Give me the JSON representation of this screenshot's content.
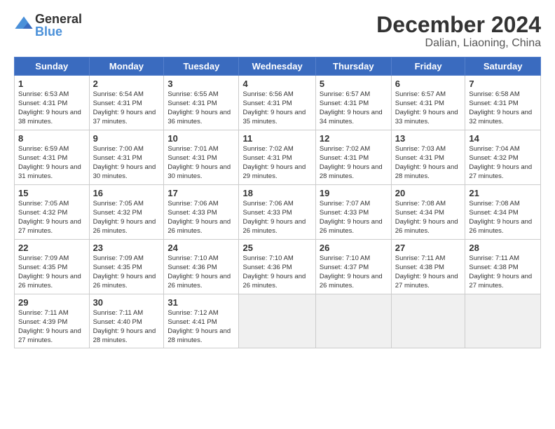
{
  "logo": {
    "text_general": "General",
    "text_blue": "Blue"
  },
  "header": {
    "title": "December 2024",
    "subtitle": "Dalian, Liaoning, China"
  },
  "weekdays": [
    "Sunday",
    "Monday",
    "Tuesday",
    "Wednesday",
    "Thursday",
    "Friday",
    "Saturday"
  ],
  "weeks": [
    [
      {
        "day": "1",
        "sunrise": "6:53 AM",
        "sunset": "4:31 PM",
        "daylight": "9 hours and 38 minutes."
      },
      {
        "day": "2",
        "sunrise": "6:54 AM",
        "sunset": "4:31 PM",
        "daylight": "9 hours and 37 minutes."
      },
      {
        "day": "3",
        "sunrise": "6:55 AM",
        "sunset": "4:31 PM",
        "daylight": "9 hours and 36 minutes."
      },
      {
        "day": "4",
        "sunrise": "6:56 AM",
        "sunset": "4:31 PM",
        "daylight": "9 hours and 35 minutes."
      },
      {
        "day": "5",
        "sunrise": "6:57 AM",
        "sunset": "4:31 PM",
        "daylight": "9 hours and 34 minutes."
      },
      {
        "day": "6",
        "sunrise": "6:57 AM",
        "sunset": "4:31 PM",
        "daylight": "9 hours and 33 minutes."
      },
      {
        "day": "7",
        "sunrise": "6:58 AM",
        "sunset": "4:31 PM",
        "daylight": "9 hours and 32 minutes."
      }
    ],
    [
      {
        "day": "8",
        "sunrise": "6:59 AM",
        "sunset": "4:31 PM",
        "daylight": "9 hours and 31 minutes."
      },
      {
        "day": "9",
        "sunrise": "7:00 AM",
        "sunset": "4:31 PM",
        "daylight": "9 hours and 30 minutes."
      },
      {
        "day": "10",
        "sunrise": "7:01 AM",
        "sunset": "4:31 PM",
        "daylight": "9 hours and 30 minutes."
      },
      {
        "day": "11",
        "sunrise": "7:02 AM",
        "sunset": "4:31 PM",
        "daylight": "9 hours and 29 minutes."
      },
      {
        "day": "12",
        "sunrise": "7:02 AM",
        "sunset": "4:31 PM",
        "daylight": "9 hours and 28 minutes."
      },
      {
        "day": "13",
        "sunrise": "7:03 AM",
        "sunset": "4:31 PM",
        "daylight": "9 hours and 28 minutes."
      },
      {
        "day": "14",
        "sunrise": "7:04 AM",
        "sunset": "4:32 PM",
        "daylight": "9 hours and 27 minutes."
      }
    ],
    [
      {
        "day": "15",
        "sunrise": "7:05 AM",
        "sunset": "4:32 PM",
        "daylight": "9 hours and 27 minutes."
      },
      {
        "day": "16",
        "sunrise": "7:05 AM",
        "sunset": "4:32 PM",
        "daylight": "9 hours and 26 minutes."
      },
      {
        "day": "17",
        "sunrise": "7:06 AM",
        "sunset": "4:33 PM",
        "daylight": "9 hours and 26 minutes."
      },
      {
        "day": "18",
        "sunrise": "7:06 AM",
        "sunset": "4:33 PM",
        "daylight": "9 hours and 26 minutes."
      },
      {
        "day": "19",
        "sunrise": "7:07 AM",
        "sunset": "4:33 PM",
        "daylight": "9 hours and 26 minutes."
      },
      {
        "day": "20",
        "sunrise": "7:08 AM",
        "sunset": "4:34 PM",
        "daylight": "9 hours and 26 minutes."
      },
      {
        "day": "21",
        "sunrise": "7:08 AM",
        "sunset": "4:34 PM",
        "daylight": "9 hours and 26 minutes."
      }
    ],
    [
      {
        "day": "22",
        "sunrise": "7:09 AM",
        "sunset": "4:35 PM",
        "daylight": "9 hours and 26 minutes."
      },
      {
        "day": "23",
        "sunrise": "7:09 AM",
        "sunset": "4:35 PM",
        "daylight": "9 hours and 26 minutes."
      },
      {
        "day": "24",
        "sunrise": "7:10 AM",
        "sunset": "4:36 PM",
        "daylight": "9 hours and 26 minutes."
      },
      {
        "day": "25",
        "sunrise": "7:10 AM",
        "sunset": "4:36 PM",
        "daylight": "9 hours and 26 minutes."
      },
      {
        "day": "26",
        "sunrise": "7:10 AM",
        "sunset": "4:37 PM",
        "daylight": "9 hours and 26 minutes."
      },
      {
        "day": "27",
        "sunrise": "7:11 AM",
        "sunset": "4:38 PM",
        "daylight": "9 hours and 27 minutes."
      },
      {
        "day": "28",
        "sunrise": "7:11 AM",
        "sunset": "4:38 PM",
        "daylight": "9 hours and 27 minutes."
      }
    ],
    [
      {
        "day": "29",
        "sunrise": "7:11 AM",
        "sunset": "4:39 PM",
        "daylight": "9 hours and 27 minutes."
      },
      {
        "day": "30",
        "sunrise": "7:11 AM",
        "sunset": "4:40 PM",
        "daylight": "9 hours and 28 minutes."
      },
      {
        "day": "31",
        "sunrise": "7:12 AM",
        "sunset": "4:41 PM",
        "daylight": "9 hours and 28 minutes."
      },
      null,
      null,
      null,
      null
    ]
  ]
}
